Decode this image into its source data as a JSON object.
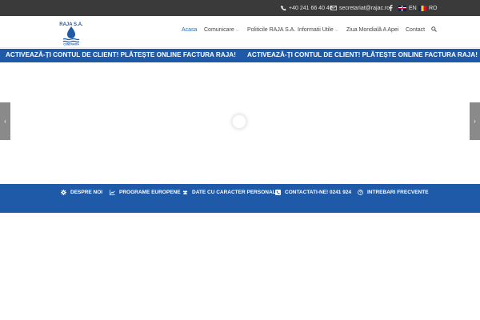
{
  "topbar": {
    "phone": "+40 241 66 40 46",
    "email": "secretariat@rajac.ro",
    "lang_en": "EN",
    "lang_ro": "RO"
  },
  "logo": {
    "text_top": "RAJA S.A.",
    "text_bottom": "CONSTANTA"
  },
  "nav": {
    "items": [
      {
        "label": "Acasa",
        "dropdown": false,
        "active": true
      },
      {
        "label": "Comunicare",
        "dropdown": true
      },
      {
        "label": "Politicile RAJA S.A.",
        "dropdown": false
      },
      {
        "label": "Informatii Utile",
        "dropdown": true
      },
      {
        "label": "Ziua Mondială A Apei",
        "dropdown": false
      },
      {
        "label": "Contact",
        "dropdown": false
      }
    ]
  },
  "marquee": {
    "text": "ACTIVEAZĂ-ȚI CONTUL DE CLIENT! PLĂTEȘTE ONLINE FACTURA RAJA!"
  },
  "quicklinks": [
    {
      "label": "DESPRE NOI",
      "icon": "gear-icon"
    },
    {
      "label": "PROGRAME EUROPENE",
      "icon": "chart-icon"
    },
    {
      "label": "DATE CU CARACTER PERSONAL",
      "icon": "users-icon"
    },
    {
      "label": "CONTACTATI-NE! 0241 924",
      "icon": "phone-square-icon"
    },
    {
      "label": "INTREBARI FRECVENTE",
      "icon": "question-icon"
    }
  ],
  "colors": {
    "brand_blue": "#1e5aa8",
    "topbar": "#3a3a3a",
    "nav_active": "#1e6fb6"
  }
}
